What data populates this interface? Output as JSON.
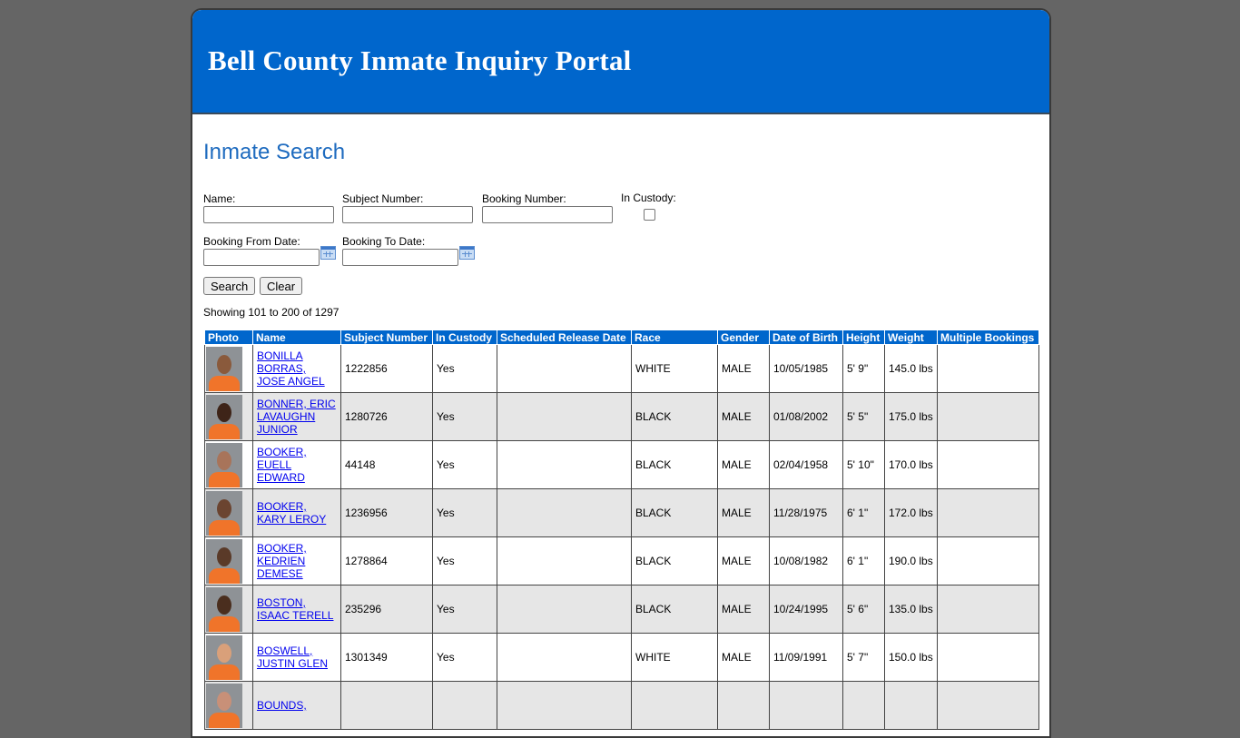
{
  "banner": {
    "title": "Bell County Inmate Inquiry Portal"
  },
  "search": {
    "title": "Inmate Search",
    "name_label": "Name:",
    "name_value": "",
    "subject_label": "Subject Number:",
    "subject_value": "",
    "booking_label": "Booking Number:",
    "booking_value": "",
    "custody_label": "In Custody:",
    "custody_checked": false,
    "from_label": "Booking From Date:",
    "from_value": "",
    "to_label": "Booking To Date:",
    "to_value": "",
    "search_button": "Search",
    "clear_button": "Clear"
  },
  "results": {
    "showing": "Showing 101 to 200 of 1297",
    "columns": [
      "Photo",
      "Name",
      "Subject Number",
      "In Custody",
      "Scheduled Release Date",
      "Race",
      "Gender",
      "Date of Birth",
      "Height",
      "Weight",
      "Multiple Bookings"
    ],
    "rows": [
      {
        "name": "BONILLA BORRAS, JOSE ANGEL",
        "subject": "1222856",
        "custody": "Yes",
        "release": "",
        "race": "WHITE",
        "gender": "MALE",
        "dob": "10/05/1985",
        "height": "5' 9\"",
        "weight": "145.0 lbs",
        "multiple": ""
      },
      {
        "name": "BONNER, ERIC LAVAUGHN JUNIOR",
        "subject": "1280726",
        "custody": "Yes",
        "release": "",
        "race": "BLACK",
        "gender": "MALE",
        "dob": "01/08/2002",
        "height": "5' 5\"",
        "weight": "175.0 lbs",
        "multiple": ""
      },
      {
        "name": "BOOKER, EUELL EDWARD",
        "subject": "44148",
        "custody": "Yes",
        "release": "",
        "race": "BLACK",
        "gender": "MALE",
        "dob": "02/04/1958",
        "height": "5' 10\"",
        "weight": "170.0 lbs",
        "multiple": ""
      },
      {
        "name": "BOOKER, KARY LEROY",
        "subject": "1236956",
        "custody": "Yes",
        "release": "",
        "race": "BLACK",
        "gender": "MALE",
        "dob": "11/28/1975",
        "height": "6' 1\"",
        "weight": "172.0 lbs",
        "multiple": ""
      },
      {
        "name": "BOOKER, KEDRIEN DEMESE",
        "subject": "1278864",
        "custody": "Yes",
        "release": "",
        "race": "BLACK",
        "gender": "MALE",
        "dob": "10/08/1982",
        "height": "6' 1\"",
        "weight": "190.0 lbs",
        "multiple": ""
      },
      {
        "name": "BOSTON, ISAAC TERELL",
        "subject": "235296",
        "custody": "Yes",
        "release": "",
        "race": "BLACK",
        "gender": "MALE",
        "dob": "10/24/1995",
        "height": "5' 6\"",
        "weight": "135.0 lbs",
        "multiple": ""
      },
      {
        "name": "BOSWELL, JUSTIN GLEN",
        "subject": "1301349",
        "custody": "Yes",
        "release": "",
        "race": "WHITE",
        "gender": "MALE",
        "dob": "11/09/1991",
        "height": "5' 7\"",
        "weight": "150.0 lbs",
        "multiple": ""
      },
      {
        "name": "BOUNDS,",
        "subject": "",
        "custody": "",
        "release": "",
        "race": "",
        "gender": "",
        "dob": "",
        "height": "",
        "weight": "",
        "multiple": ""
      }
    ],
    "photo_colors": [
      "#8a5a3c",
      "#3e2418",
      "#a8745a",
      "#6b4430",
      "#5a3a28",
      "#4a2e1e",
      "#d9a07a",
      "#c89078"
    ]
  }
}
